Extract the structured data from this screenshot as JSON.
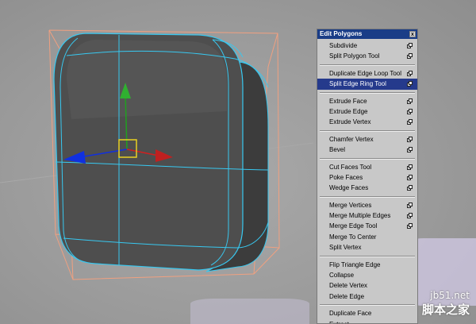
{
  "menu": {
    "title": "Edit Polygons",
    "close_label": "x",
    "selected_item": "Split Edge Ring Tool",
    "groups": [
      [
        {
          "label": "Subdivide",
          "has_option": true
        },
        {
          "label": "Split Polygon Tool",
          "has_option": true
        }
      ],
      [
        {
          "label": "Duplicate Edge Loop Tool",
          "has_option": true
        },
        {
          "label": "Split Edge Ring Tool",
          "has_option": true
        }
      ],
      [
        {
          "label": "Extrude Face",
          "has_option": true
        },
        {
          "label": "Extrude Edge",
          "has_option": true
        },
        {
          "label": "Extrude Vertex",
          "has_option": true
        }
      ],
      [
        {
          "label": "Chamfer Vertex",
          "has_option": true
        },
        {
          "label": "Bevel",
          "has_option": true
        }
      ],
      [
        {
          "label": "Cut Faces Tool",
          "has_option": true
        },
        {
          "label": "Poke Faces",
          "has_option": true
        },
        {
          "label": "Wedge Faces",
          "has_option": true
        }
      ],
      [
        {
          "label": "Merge Vertices",
          "has_option": true
        },
        {
          "label": "Merge Multiple Edges",
          "has_option": true
        },
        {
          "label": "Merge Edge Tool",
          "has_option": true
        },
        {
          "label": "Merge To Center",
          "has_option": false
        },
        {
          "label": "Split Vertex",
          "has_option": false
        }
      ],
      [
        {
          "label": "Flip Triangle Edge",
          "has_option": false
        },
        {
          "label": "Collapse",
          "has_option": false
        },
        {
          "label": "Delete Vertex",
          "has_option": false
        },
        {
          "label": "Delete Edge",
          "has_option": false
        }
      ],
      [
        {
          "label": "Duplicate Face",
          "has_option": false
        },
        {
          "label": "Extract",
          "has_option": false
        }
      ]
    ]
  },
  "watermark": {
    "url": "jb51.net",
    "site": "脚本之家"
  },
  "colors": {
    "viewport_bg": "#9e9e9e",
    "mesh_fill": "#505050",
    "wireframe": "#38c8f0",
    "bounding_box": "#f0a080",
    "axis_x": "#d02020",
    "axis_y": "#20a020",
    "axis_z": "#1030e0",
    "manipulator_center": "#e8d020",
    "menu_title_bg": "#1a3d87",
    "menu_selected_bg": "#253a8c"
  },
  "icons": [
    "close-icon",
    "option-box-icon",
    "move-manipulator-icon"
  ]
}
